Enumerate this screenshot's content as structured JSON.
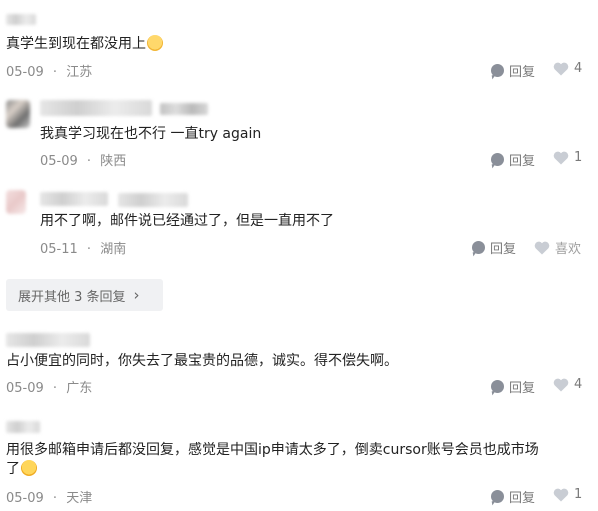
{
  "comments": [
    {
      "text": "真学生到现在都没用上",
      "date": "05-09",
      "location": "江苏",
      "reply_label": "回复",
      "likes": "4"
    },
    {
      "text": "我真学习现在也不行 一直try again",
      "date": "05-09",
      "location": "陕西",
      "reply_label": "回复",
      "likes": "1"
    },
    {
      "text": "用不了啊，邮件说已经通过了，但是一直用不了",
      "date": "05-11",
      "location": "湖南",
      "reply_label": "回复",
      "likes": "喜欢"
    },
    {
      "text": "占小便宜的同时，你失去了最宝贵的品德，诚实。得不偿失啊。",
      "date": "05-09",
      "location": "广东",
      "reply_label": "回复",
      "likes": "4"
    },
    {
      "text_line1": "用很多邮箱申请后都没回复，感觉是中国ip申请太多了，倒卖cursor账号会员也成市场",
      "text_line2": "了",
      "date": "05-09",
      "location": "天津",
      "reply_label": "回复",
      "likes": "1"
    }
  ],
  "expand": {
    "label": "展开其他 3 条回复",
    "arrow": "›"
  },
  "separator": "·",
  "icons": {
    "reply": "reply-bubble-icon",
    "like": "heart-icon",
    "emoji_1": "smiling-tear-emoji",
    "emoji_5": "tired-face-emoji"
  },
  "colors": {
    "meta": "#8a8a8a",
    "icon": "#8a8f99",
    "heart": "#c9cdd4",
    "expand_bg": "#f0f1f3"
  }
}
